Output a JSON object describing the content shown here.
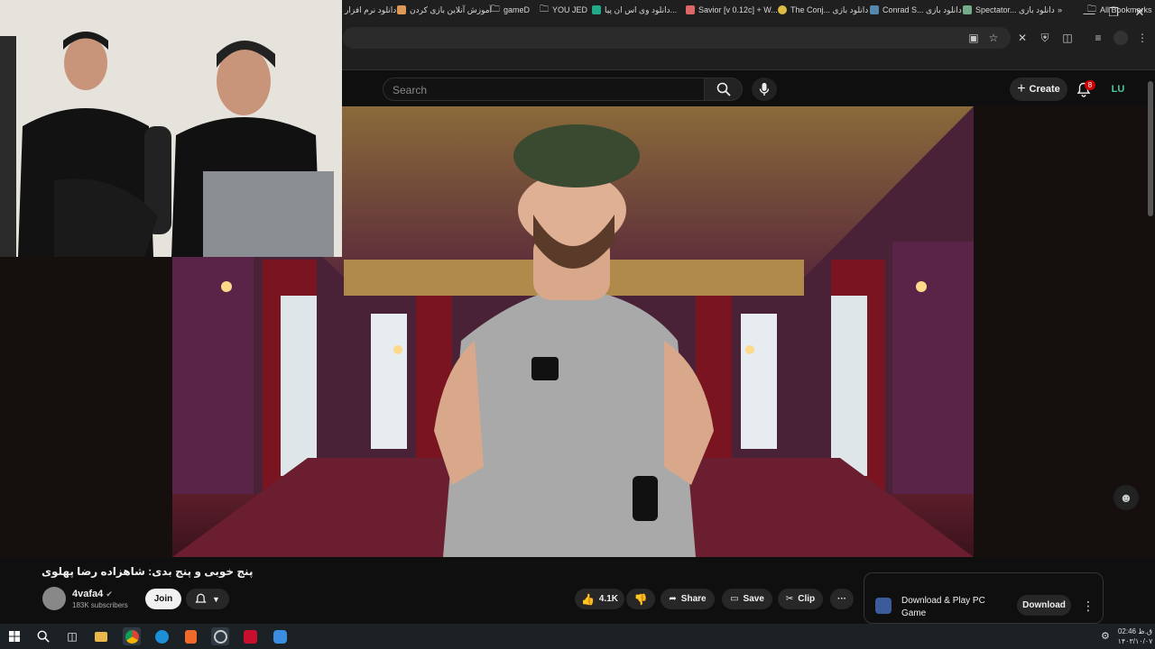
{
  "browser": {
    "bookmarks": [
      {
        "label": "دانلود نرم افزار",
        "color": "#9aa"
      },
      {
        "label": "آموزش آنلاین بازی کردن",
        "color": "#d95"
      },
      {
        "label": "gameD",
        "color": "#ccc"
      },
      {
        "label": "YOU JED",
        "color": "#ccc"
      },
      {
        "label": "دانلود وی اس ان پیا...",
        "color": "#2a8"
      },
      {
        "label": "Savior [v 0.12c] + W...",
        "color": "#d66"
      },
      {
        "label": "The Conj... دانلود بازی",
        "color": "#db4"
      },
      {
        "label": "Conrad S... دانلود بازی",
        "color": "#58a"
      },
      {
        "label": "Spectator... دانلود بازی",
        "color": "#7a8"
      }
    ],
    "all_bookmarks": "All Bookmarks"
  },
  "youtube": {
    "search_placeholder": "Search",
    "create_label": "Create",
    "notification_count": "8",
    "avatar_initials": "LU"
  },
  "video": {
    "title": "پنج خوبی و پنج بدی: شاهزاده رضا پهلوی",
    "channel_name": "4vafa4",
    "subscribers": "183K subscribers",
    "join_label": "Join",
    "likes": "4.1K",
    "share_label": "Share",
    "save_label": "Save",
    "clip_label": "Clip"
  },
  "ad": {
    "title": "Download & Play PC Game",
    "button": "Download"
  },
  "taskbar": {
    "time": "02:46 ق.ظ",
    "date": "۱۴۰۳/۱۰/۰۷"
  },
  "colors": {
    "accent": "#cc0000",
    "background": "#0f0f0f"
  }
}
